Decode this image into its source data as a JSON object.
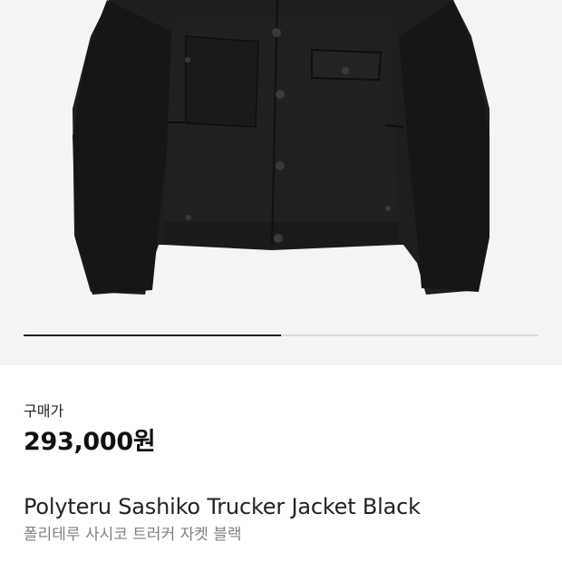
{
  "product": {
    "image_icon": "jacket-product-photo",
    "image_slider_progress": 0.5,
    "price_label": "구매가",
    "price": "293,000원",
    "name_en": "Polyteru Sashiko Trucker Jacket Black",
    "name_ko": "폴리테루 사시코 트러커 자켓 블랙"
  },
  "colors": {
    "hero_background": "#f4f4f4",
    "jacket": "#1c1c1c",
    "progress_active": "#222222",
    "progress_track": "#d9d9d9",
    "subtitle": "#808080"
  }
}
